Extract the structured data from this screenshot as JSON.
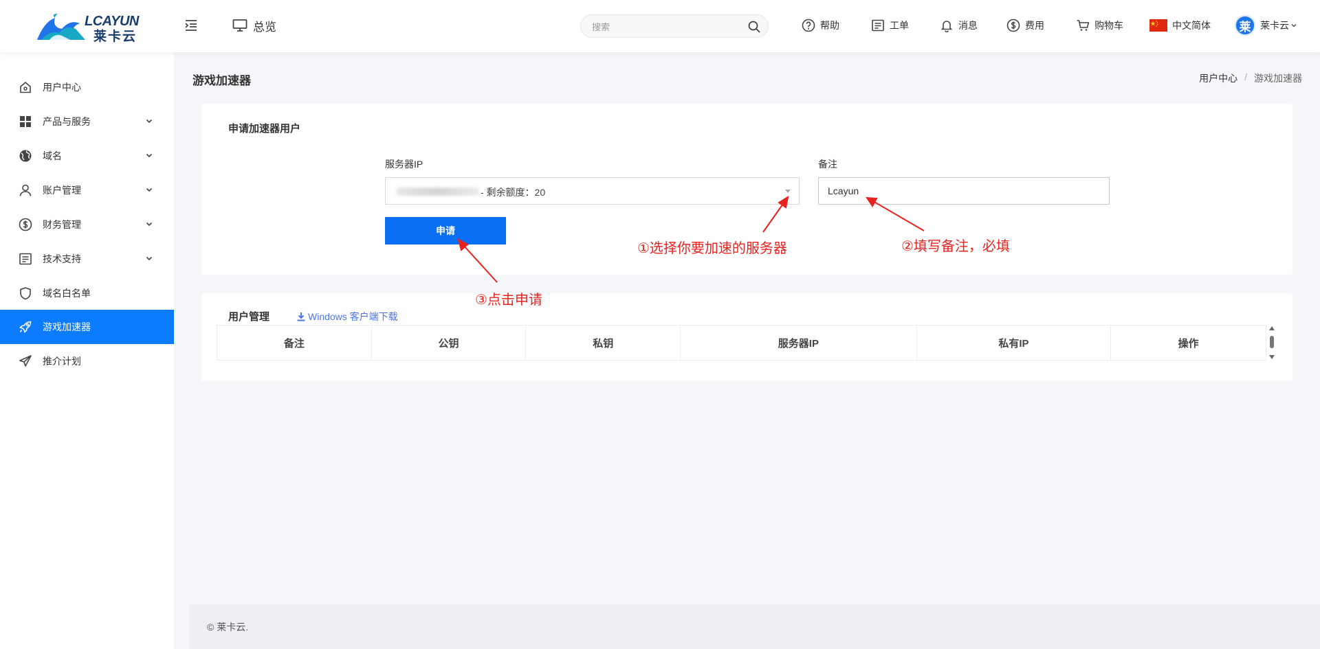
{
  "header": {
    "logo_en": "LCAYUN",
    "logo_cn": "莱卡云",
    "overview_label": "总览",
    "search_placeholder": "搜索",
    "nav": {
      "help": "帮助",
      "ticket": "工单",
      "message": "消息",
      "billing": "费用",
      "cart": "购物车",
      "language": "中文简体",
      "user_name": "莱卡云",
      "avatar_char": "莱"
    }
  },
  "sidebar": {
    "items": [
      {
        "label": "用户中心",
        "icon": "home-icon",
        "has_children": false
      },
      {
        "label": "产品与服务",
        "icon": "grid-icon",
        "has_children": true
      },
      {
        "label": "域名",
        "icon": "globe-icon",
        "has_children": true
      },
      {
        "label": "账户管理",
        "icon": "user-icon",
        "has_children": true
      },
      {
        "label": "财务管理",
        "icon": "dollar-icon",
        "has_children": true
      },
      {
        "label": "技术支持",
        "icon": "document-icon",
        "has_children": true
      },
      {
        "label": "域名白名单",
        "icon": "shield-icon",
        "has_children": false
      },
      {
        "label": "游戏加速器",
        "icon": "rocket-icon",
        "has_children": false,
        "active": true
      },
      {
        "label": "推介计划",
        "icon": "send-icon",
        "has_children": false
      }
    ]
  },
  "page": {
    "title": "游戏加速器",
    "breadcrumb": [
      "用户中心",
      "游戏加速器"
    ]
  },
  "apply_card": {
    "title": "申请加速器用户",
    "server_ip_label": "服务器IP",
    "server_ip_value": "- 剩余额度：20",
    "remark_label": "备注",
    "remark_value": "Lcayun",
    "submit_label": "申请"
  },
  "annotations": {
    "step1": "①选择你要加速的服务器",
    "step2": "②填写备注，必填",
    "step3": "③点击申请"
  },
  "user_card": {
    "title": "用户管理",
    "download_link": "Windows 客户端下载",
    "columns": [
      "备注",
      "公钥",
      "私钥",
      "服务器IP",
      "私有IP",
      "操作"
    ]
  },
  "footer": {
    "copyright": "© 莱卡云."
  },
  "colors": {
    "accent": "#0b7cff",
    "annotation": "#e8231f",
    "link": "#4d74e8"
  }
}
